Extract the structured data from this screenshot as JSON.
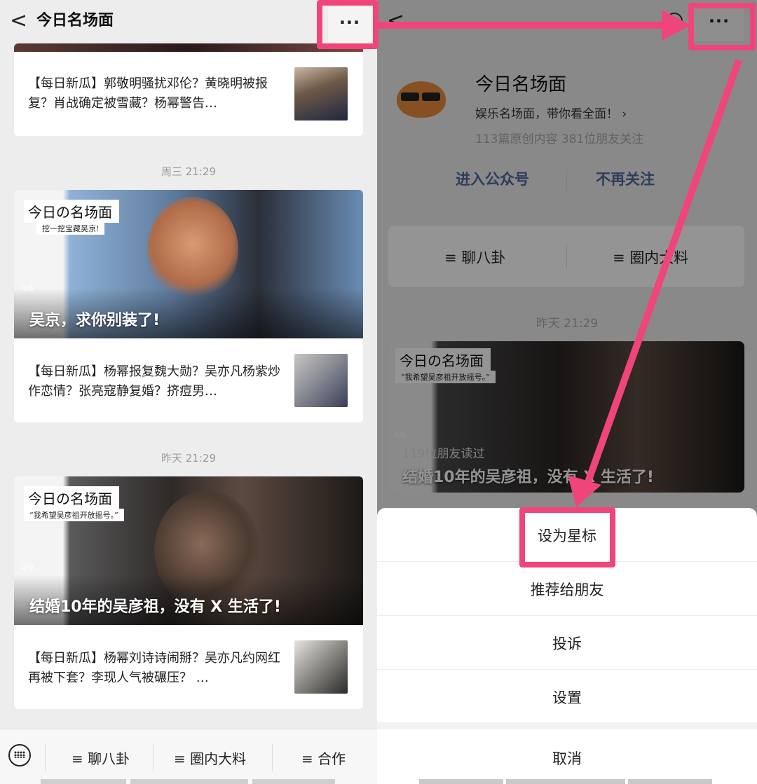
{
  "left": {
    "header": {
      "back_glyph": "<",
      "title": "今日名场面",
      "more_glyph": "···"
    },
    "articles": [
      {
        "title": "【每日新瓜】郭敬明骚扰邓伦？黄晓明被报复？肖战确定被雪藏？杨幂警告…"
      },
      {
        "timestamp": "周三 21:29",
        "cover": {
          "label": "今日の名场面",
          "subtitle": "挖一挖宝藏吴京!",
          "num": "4/8",
          "headline": "吴京，求你别装了!"
        },
        "title": "【每日新瓜】杨幂报复魏大勋？吴亦凡杨紫炒作恋情？张亮寇静复婚？挤痘男…"
      },
      {
        "timestamp": "昨天 21:29",
        "cover": {
          "label": "今日の名场面",
          "subtitle": "“我希望吴彦祖开放摇号。”",
          "num": "4/9",
          "headline": "结婚10年的吴彦祖，没有 X 生活了!"
        },
        "title": "【每日新瓜】杨幂刘诗诗闹掰？吴亦凡约网红再被下套？李现人气被碾压？ …"
      }
    ],
    "bottom_bar": {
      "items": [
        "≡ 聊八卦",
        "≡ 圈内大料",
        "≡ 合作"
      ]
    }
  },
  "right": {
    "header": {
      "more_glyph": "···"
    },
    "profile": {
      "name": "今日名场面",
      "desc": "娱乐名场面，带你看全面！ ›",
      "stats": "113篇原创内容   381位朋友关注",
      "enter_label": "进入公众号",
      "unfollow_label": "不再关注"
    },
    "menu": [
      "≡ 聊八卦",
      "≡ 圈内大料"
    ],
    "timestamp": "昨天 21:29",
    "card": {
      "label": "今日の名场面",
      "subtitle": "“我希望吴彦祖开放摇号。”",
      "num": "4/9",
      "readers": "119位朋友读过",
      "headline": "结婚10年的吴彦祖，没有 X 生活了!"
    },
    "action_sheet": {
      "items": [
        "设为星标",
        "推荐给朋友",
        "投诉",
        "设置"
      ],
      "cancel": "取消"
    }
  },
  "colors": {
    "highlight": "#f0457a",
    "link": "#4e6a9e"
  }
}
